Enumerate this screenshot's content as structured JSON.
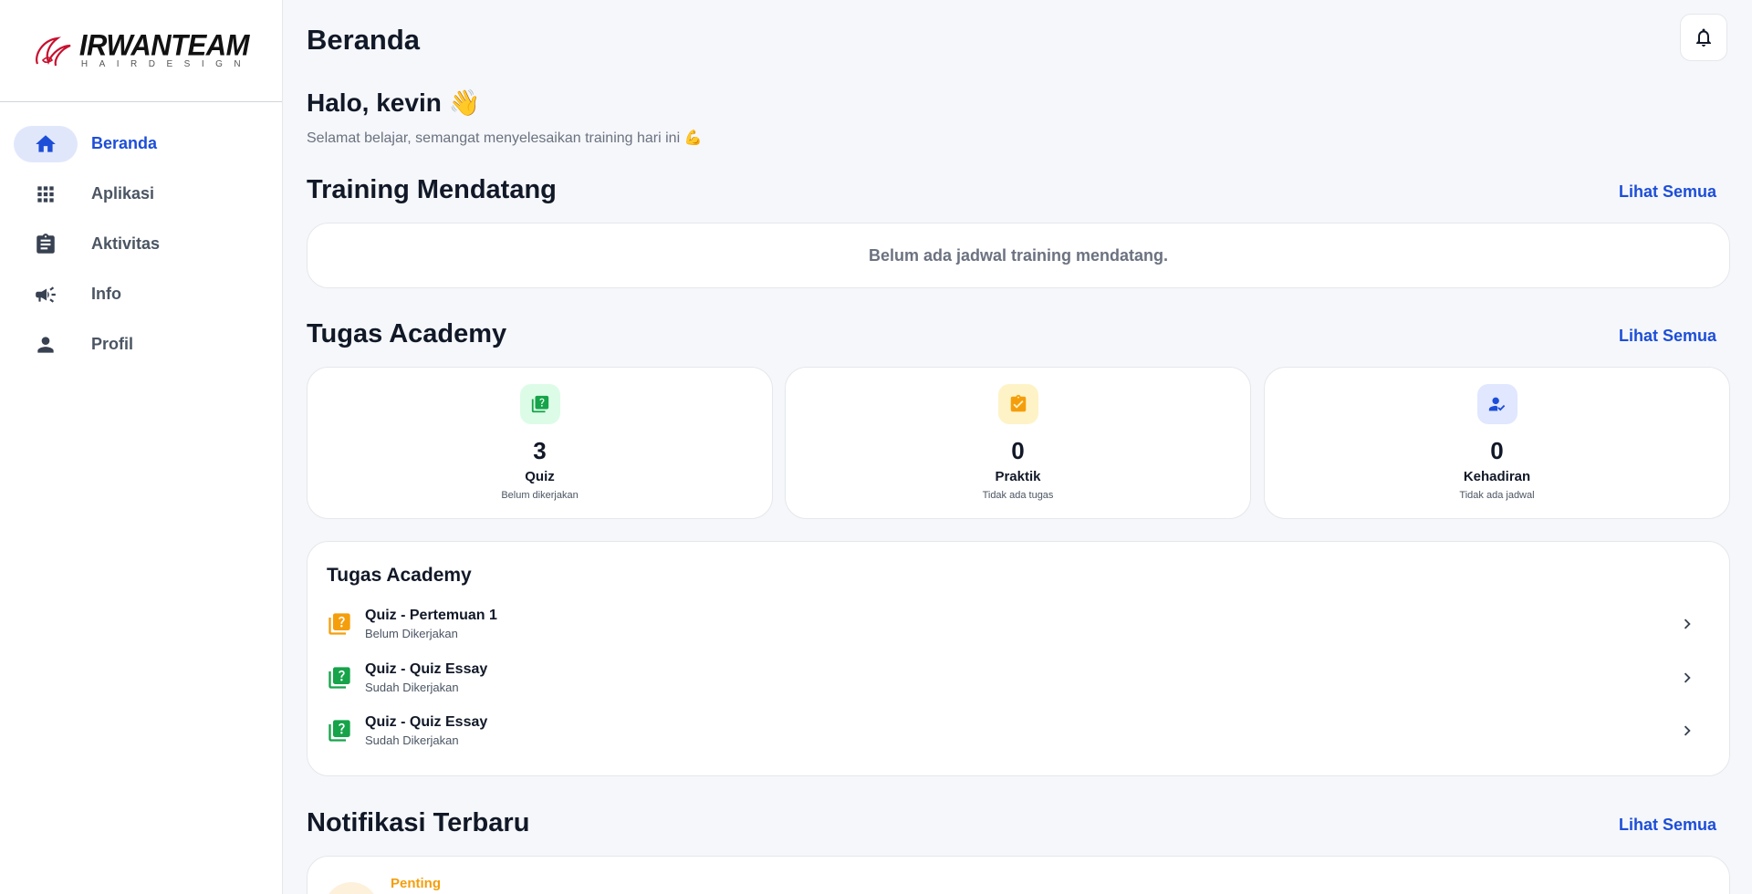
{
  "brand": {
    "name": "IRWANTEAM",
    "tagline": "HAIRDESIGN"
  },
  "sidebar": {
    "items": [
      {
        "label": "Beranda",
        "icon": "home-icon",
        "active": true
      },
      {
        "label": "Aplikasi",
        "icon": "apps-grid-icon",
        "active": false
      },
      {
        "label": "Aktivitas",
        "icon": "clipboard-icon",
        "active": false
      },
      {
        "label": "Info",
        "icon": "megaphone-icon",
        "active": false
      },
      {
        "label": "Profil",
        "icon": "person-icon",
        "active": false
      }
    ]
  },
  "header": {
    "title": "Beranda",
    "bell_icon": "bell-icon"
  },
  "greeting": {
    "title": "Halo, kevin 👋",
    "subtitle": "Selamat belajar, semangat menyelesaikan training hari ini 💪"
  },
  "training": {
    "title": "Training Mendatang",
    "see_all": "Lihat Semua",
    "empty_text": "Belum ada jadwal training mendatang."
  },
  "academy": {
    "title": "Tugas Academy",
    "see_all": "Lihat Semua",
    "stats": [
      {
        "value": "3",
        "label": "Quiz",
        "desc": "Belum dikerjakan",
        "icon": "quiz-icon",
        "color": "#16a34a",
        "bg": "#dcfce7"
      },
      {
        "value": "0",
        "label": "Praktik",
        "desc": "Tidak ada tugas",
        "icon": "task-check-icon",
        "color": "#f59e0b",
        "bg": "#fef3c7"
      },
      {
        "value": "0",
        "label": "Kehadiran",
        "desc": "Tidak ada jadwal",
        "icon": "attendance-icon",
        "color": "#1d4ed8",
        "bg": "#e0e7ff"
      }
    ]
  },
  "academy_list": {
    "title": "Tugas Academy",
    "items": [
      {
        "title": "Quiz - Pertemuan 1",
        "status": "Belum Dikerjakan",
        "color": "#f59e0b"
      },
      {
        "title": "Quiz - Quiz Essay",
        "status": "Sudah Dikerjakan",
        "color": "#16a34a"
      },
      {
        "title": "Quiz - Quiz Essay",
        "status": "Sudah Dikerjakan",
        "color": "#16a34a"
      }
    ]
  },
  "notifications": {
    "title": "Notifikasi Terbaru",
    "see_all": "Lihat Semua",
    "first_tag": "Penting"
  }
}
